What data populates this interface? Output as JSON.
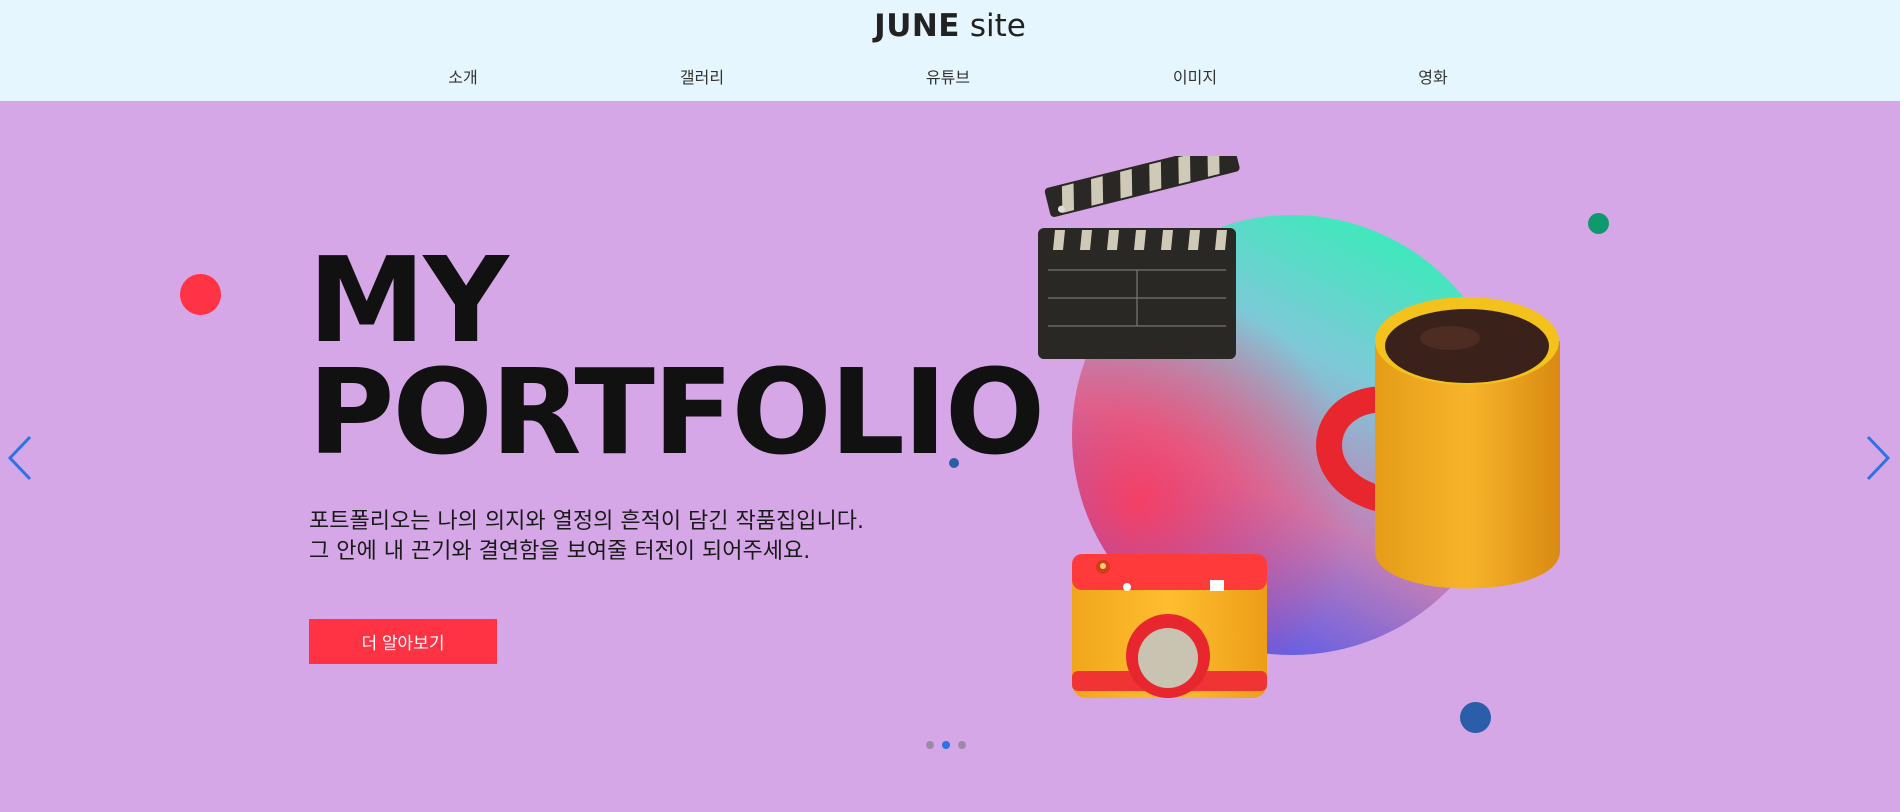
{
  "header": {
    "logo_strong": "JUNE",
    "logo_light": " site",
    "nav": [
      {
        "label": "소개"
      },
      {
        "label": "갤러리"
      },
      {
        "label": "유튜브"
      },
      {
        "label": "이미지"
      },
      {
        "label": "영화"
      }
    ]
  },
  "hero": {
    "title_line1": "MY",
    "title_line2": "PORTFOLIO",
    "desc_line1": "포트폴리오는 나의 의지와 열정의 흔적이 담긴 작품집입니다.",
    "desc_line2": "그 안에 내 끈기와 결연함을 보여줄 터전이 되어주세요.",
    "cta_label": "더 알아보기"
  },
  "slider": {
    "total_slides": 3,
    "active_slide": 2
  },
  "colors": {
    "header_bg": "#e6f6ff",
    "hero_bg": "#d5a7e7",
    "accent_red": "#ff3344",
    "arrow_blue": "#2d72e6",
    "deco_green": "#0e9a6e",
    "deco_navy": "#2b5ea8"
  },
  "icons": [
    "chevron-left-icon",
    "chevron-right-icon",
    "clapperboard-illustration",
    "camera-illustration",
    "coffee-mug-illustration"
  ]
}
